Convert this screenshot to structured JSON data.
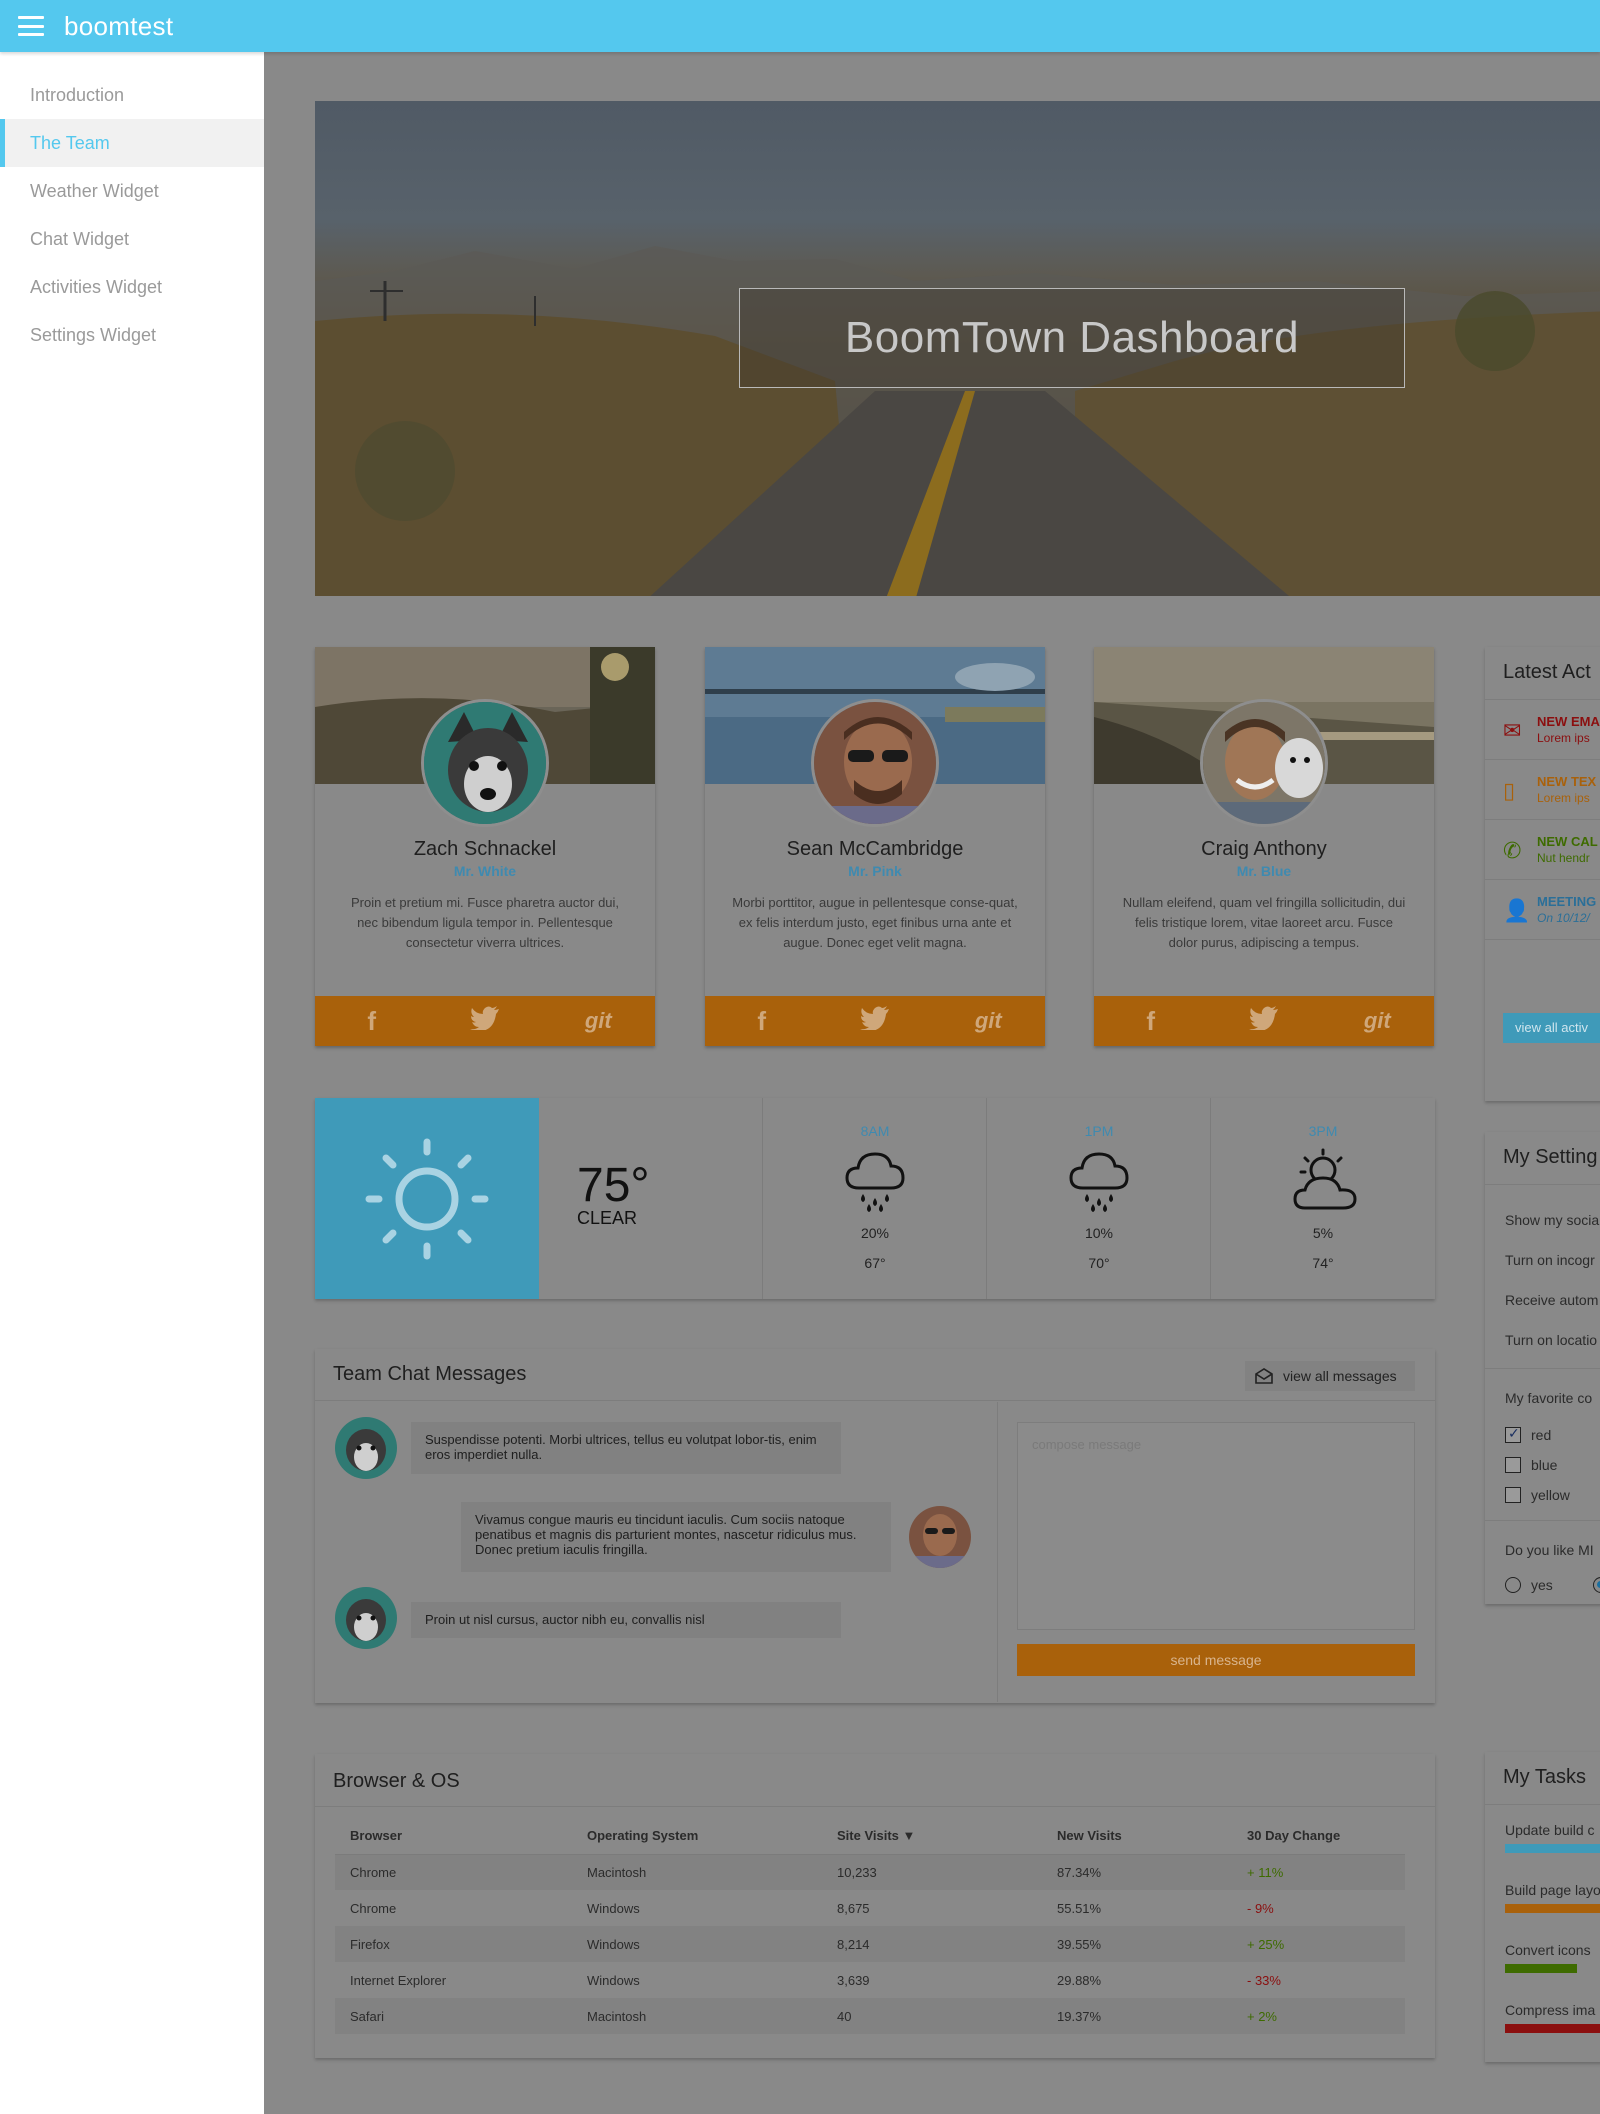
{
  "app": {
    "title": "boomtest"
  },
  "sidebar": {
    "items": [
      {
        "label": "Introduction"
      },
      {
        "label": "The Team"
      },
      {
        "label": "Weather Widget"
      },
      {
        "label": "Chat Widget"
      },
      {
        "label": "Activities Widget"
      },
      {
        "label": "Settings Widget"
      }
    ],
    "active": "The Team"
  },
  "hero": {
    "title": "BoomTown Dashboard"
  },
  "team": [
    {
      "name": "Zach Schnackel",
      "alias": "Mr. White",
      "bio": "Proin et pretium mi. Fusce pharetra auctor dui, nec bibendum ligula tempor in. Pellentesque consectetur viverra ultrices.",
      "social": [
        "f",
        "twitter",
        "git"
      ]
    },
    {
      "name": "Sean McCambridge",
      "alias": "Mr. Pink",
      "bio": "Morbi porttitor, augue in pellentesque conse-quat, ex felis interdum justo, eget finibus urna ante et augue. Donec eget velit magna.",
      "social": [
        "f",
        "twitter",
        "git"
      ]
    },
    {
      "name": "Craig Anthony",
      "alias": "Mr. Blue",
      "bio": "Nullam eleifend, quam vel fringilla sollicitudin, dui felis tristique lorem, vitae laoreet arcu. Fusce dolor purus, adipiscing a tempus.",
      "social": [
        "f",
        "twitter",
        "git"
      ]
    }
  ],
  "social_labels": {
    "facebook": "f",
    "twitter": "🐦",
    "git": "git"
  },
  "weather": {
    "current": {
      "temp": "75°",
      "condition": "CLEAR",
      "icon": "sun-icon"
    },
    "forecast": [
      {
        "time": "8AM",
        "pct": "20%",
        "temp": "67°",
        "icon": "rain-cloud-icon"
      },
      {
        "time": "1PM",
        "pct": "10%",
        "temp": "70°",
        "icon": "rain-cloud-icon"
      },
      {
        "time": "3PM",
        "pct": "5%",
        "temp": "74°",
        "icon": "partly-cloudy-icon"
      }
    ]
  },
  "chat": {
    "title": "Team Chat Messages",
    "view_all": "view all messages",
    "messages": [
      {
        "text": "Suspendisse potenti. Morbi ultrices, tellus eu volutpat lobor-tis, enim eros imperdiet nulla.",
        "side": "left"
      },
      {
        "text": "Vivamus congue mauris eu tincidunt iaculis. Cum sociis natoque penatibus et magnis dis parturient montes, nascetur ridiculus mus. Donec pretium iaculis fringilla.",
        "side": "right"
      },
      {
        "text": "Proin ut nisl cursus, auctor nibh eu, convallis nisl",
        "side": "left"
      }
    ],
    "compose_placeholder": "compose message",
    "send_label": "send message"
  },
  "browser_os": {
    "title": "Browser & OS",
    "columns": [
      "Browser",
      "Operating System",
      "Site Visits ▼",
      "New Visits",
      "30 Day Change"
    ],
    "rows": [
      [
        "Chrome",
        "Macintosh",
        "10,233",
        "87.34%",
        "+ 11%"
      ],
      [
        "Chrome",
        "Windows",
        "8,675",
        "55.51%",
        "- 9%"
      ],
      [
        "Firefox",
        "Windows",
        "8,214",
        "39.55%",
        "+ 25%"
      ],
      [
        "Internet Explorer",
        "Windows",
        "3,639",
        "29.88%",
        "- 33%"
      ],
      [
        "Safari",
        "Macintosh",
        "40",
        "19.37%",
        "+ 2%"
      ]
    ]
  },
  "activity": {
    "title": "Latest Act",
    "items": [
      {
        "title": "NEW EMA",
        "sub": "Lorem ips",
        "color": "#8b0f0f",
        "icon": "envelope-icon"
      },
      {
        "title": "NEW TEX",
        "sub": "Lorem ips",
        "color": "#a9610b",
        "icon": "phone-text-icon"
      },
      {
        "title": "NEW CAL",
        "sub": "Nut hendr",
        "color": "#3e6b00",
        "icon": "phone-icon"
      },
      {
        "title": "MEETING",
        "sub": "On 10/12/",
        "color": "#2b6f98",
        "icon": "meeting-icon"
      }
    ],
    "view_all": "view all activ"
  },
  "settings": {
    "title": "My Setting",
    "toggles": [
      "Show my socia",
      "Turn on incogr",
      "Receive autom",
      "Turn on locatio"
    ],
    "color_question": "My favorite co",
    "colors": [
      {
        "label": "red",
        "checked": true
      },
      {
        "label": "blue",
        "checked": false
      },
      {
        "label": "yellow",
        "checked": false
      }
    ],
    "like_question": "Do you like MI",
    "like_options": [
      {
        "label": "yes",
        "selected": false
      },
      {
        "label": "",
        "selected": true
      }
    ]
  },
  "tasks": {
    "title": "My Tasks",
    "items": [
      {
        "label": "Update build c",
        "color": "#3f9ab9"
      },
      {
        "label": "Build page layo",
        "color": "#a9610b"
      },
      {
        "label": "Convert icons",
        "color": "#3e6b00"
      },
      {
        "label": "Compress ima",
        "color": "#8b0f0f"
      }
    ]
  }
}
